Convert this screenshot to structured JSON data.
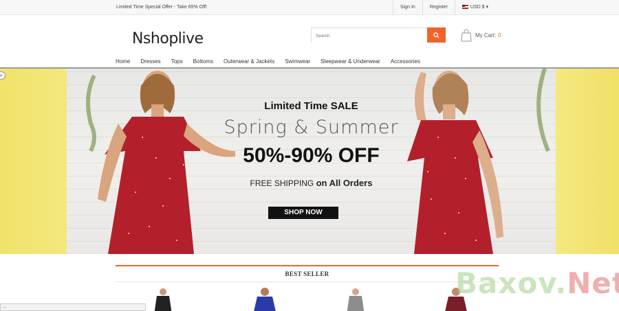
{
  "topbar": {
    "offer": "Limited Time Special Offer - Take 65% Off!",
    "sign_in": "Sign In",
    "register": "Register",
    "currency": "USD $"
  },
  "header": {
    "logo": "Nshoplive",
    "search_placeholder": "Search",
    "cart_label": "My Cart:",
    "cart_count": "0"
  },
  "nav": {
    "items": [
      "Home",
      "Dresses",
      "Tops",
      "Bottoms",
      "Outerwear & Jackets",
      "Swimwear",
      "Sleepwear & Underwear",
      "Accessories"
    ]
  },
  "banner": {
    "headline": "Limited Time SALE",
    "season": "Spring & Summer",
    "discount": "50%-90% OFF",
    "shipping_a": "FREE SHIPPING",
    "shipping_b": "on All Orders",
    "cta": "SHOP NOW"
  },
  "best_seller": {
    "title": "BEST SELLER"
  },
  "status_bar": "...",
  "watermark": {
    "part1": "Baxov.",
    "part2": "Net"
  },
  "colors": {
    "accent": "#f2632a",
    "dress_red": "#b3202b",
    "side_yellow": "#f0e36a"
  }
}
